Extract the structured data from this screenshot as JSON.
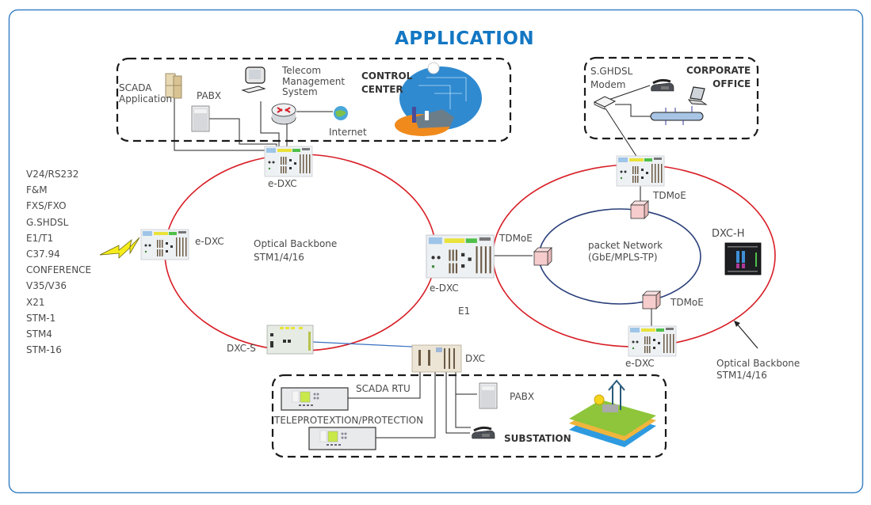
{
  "title": "APPLICATION",
  "colors": {
    "title": "#1377c3",
    "frame": "#3d82c6",
    "optical_ring": "#d81e26",
    "packet_ring": "#2a3f7a",
    "dxc_link": "#3a6fc0",
    "text": "#4a4a4a"
  },
  "control_center": {
    "label_line1": "CONTROL",
    "label_line2": "CENTER",
    "scada_line1": "SCADA",
    "scada_line2": "Application",
    "pabx": "PABX",
    "tms_line1": "Telecom",
    "tms_line2": "Management",
    "tms_line3": "System",
    "internet": "Internet"
  },
  "corporate_office": {
    "label_line1": "CORPORATE",
    "label_line2": "OFFICE",
    "modem_line1": "S.GHDSL",
    "modem_line2": "Modem"
  },
  "interfaces": [
    "V24/RS232",
    "F&M",
    "FXS/FXO",
    "G.SHDSL",
    "E1/T1",
    "C37.94",
    "CONFERENCE",
    "V35/V36",
    "X21",
    "STM-1",
    "STM4",
    "STM-16"
  ],
  "left_ring": {
    "label_line1": "Optical Backbone",
    "label_line2": "STM1/4/16",
    "nodes": {
      "top": "e-DXC",
      "left": "e-DXC",
      "center": "e-DXC",
      "bottom": "DXC-S"
    },
    "e1": "E1"
  },
  "right_ring": {
    "nodes": {
      "top": "TDMoE",
      "left": "TDMoE",
      "bottom": "TDMoE",
      "bottom_dxc": "e-DXC",
      "right": "DXC-H"
    },
    "packet_line1": "packet Network",
    "packet_line2": "(GbE/MPLS-TP)",
    "optical_line1": "Optical Backbone",
    "optical_line2": "STM1/4/16"
  },
  "substation": {
    "label": "SUBSTATION",
    "dxc": "DXC",
    "scada_rtu": "SCADA RTU",
    "teleprotection": "TELEPROTEXTION/PROTECTION",
    "pabx": "PABX"
  }
}
